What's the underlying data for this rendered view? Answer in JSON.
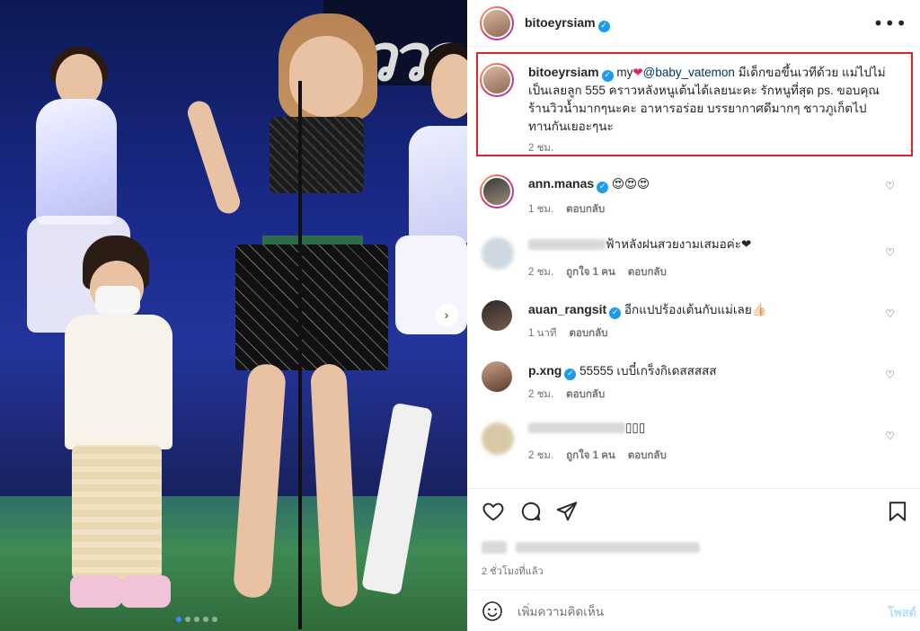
{
  "post": {
    "username": "bitoeyrsiam",
    "more_label": "•••",
    "slide_next": "›",
    "caption": {
      "username": "bitoeyrsiam",
      "prefix": "my",
      "heart": "❤",
      "mention": "@baby_vatemon",
      "body": " มีเด็กขอขึ้นเวทีด้วย แม่ไปไม่เป็นเลยลูก 555 คราวหลังหนูเต้นได้เลยนะคะ รักหนูที่สุด ps. ขอบคุณร้านวิวน้ำมากๆนะคะ อาหารอร่อย บรรยากาศดีมากๆ ชาวภูเก็ตไปทานกันเยอะๆนะ",
      "time": "2 ชม."
    },
    "comments": [
      {
        "username": "ann.manas",
        "verified": true,
        "text": "😍😍😍",
        "time": "1 ชม.",
        "likes": "",
        "reply": "ตอบกลับ"
      },
      {
        "username": "",
        "verified": false,
        "text": "ฟ้าหลังฝนสวยงามเสมอค่ะ❤",
        "time": "2 ชม.",
        "likes": "ถูกใจ 1 คน",
        "reply": "ตอบกลับ"
      },
      {
        "username": "auan_rangsit",
        "verified": true,
        "text": "อีกแปปร้องเต้นกับแม่เลย👍🏻",
        "time": "1 นาที",
        "likes": "",
        "reply": "ตอบกลับ"
      },
      {
        "username": "p.xng",
        "verified": true,
        "text": "55555 เบบี๋เกร็งกิเดสสสสส",
        "time": "2 ชม.",
        "likes": "",
        "reply": "ตอบกลับ"
      },
      {
        "username": "",
        "verified": false,
        "text": "▯▯▯",
        "time": "2 ชม.",
        "likes": "ถูกใจ 1 คน",
        "reply": "ตอบกลับ"
      }
    ],
    "timestamp": "2 ชั่วโมงที่แล้ว",
    "add_comment_placeholder": "เพิ่มความคิดเห็น",
    "post_button": "โพสต์"
  },
  "photo": {
    "sign_text": "ววว"
  },
  "colors": {
    "highlight_border": "#e02424",
    "verified": "#1d9bf0",
    "mention": "#00376b",
    "post_button": "#b2dffc"
  },
  "icons": [
    "heart-icon",
    "comment-icon",
    "share-icon",
    "bookmark-icon",
    "emoji-icon",
    "more-icon",
    "verified-icon"
  ]
}
